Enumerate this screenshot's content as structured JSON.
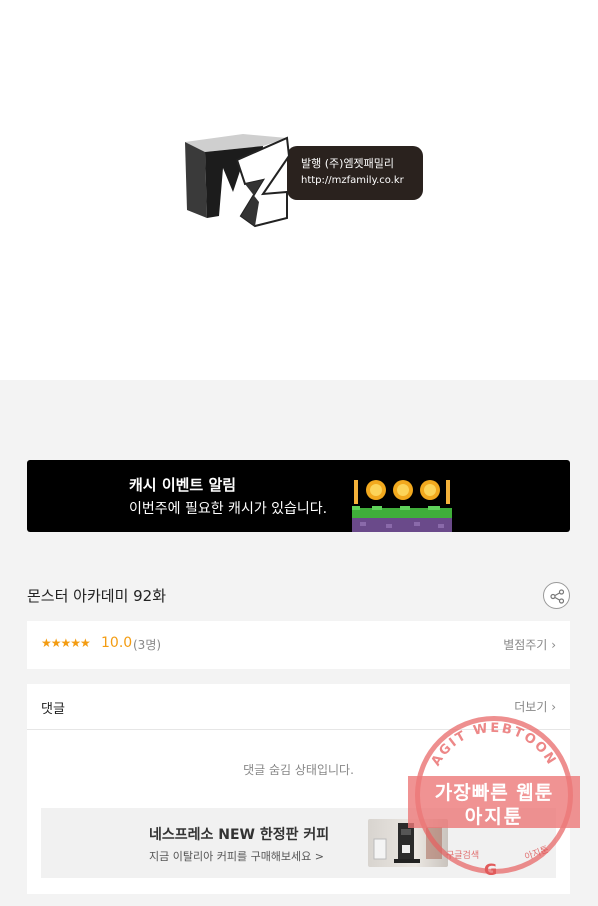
{
  "publisher": {
    "logo_text": "MZ",
    "line1": "발행 (주)엠젯패밀리",
    "line2": "http://mzfamily.co.kr"
  },
  "cash_banner": {
    "title": "캐시 이벤트 알림",
    "description": "이번주에 필요한 캐시가 있습니다."
  },
  "episode": {
    "title": "몬스터 아카데미 92화"
  },
  "rating": {
    "stars": "★★★★★",
    "value": "10.0",
    "count": "(3명)",
    "rate_label": "별점주기"
  },
  "comments": {
    "title": "댓글",
    "more_label": "더보기",
    "hidden_note": "댓글 숨김 상태입니다."
  },
  "ad": {
    "title": "네스프레소 NEW 한정판 커피",
    "description": "지금 이탈리아 커피를 구매해보세요 >"
  },
  "watermark": {
    "arc_text": "AGIT WEBTOON",
    "line1": "가장빠른 웹툰",
    "line2": "아지툰",
    "small_left": "구글검색",
    "small_right": "아지툰",
    "google_letter": "G"
  },
  "colors": {
    "rating_accent": "#f39c12",
    "page_background": "#f3f3f3",
    "watermark": "#e15b5b"
  }
}
